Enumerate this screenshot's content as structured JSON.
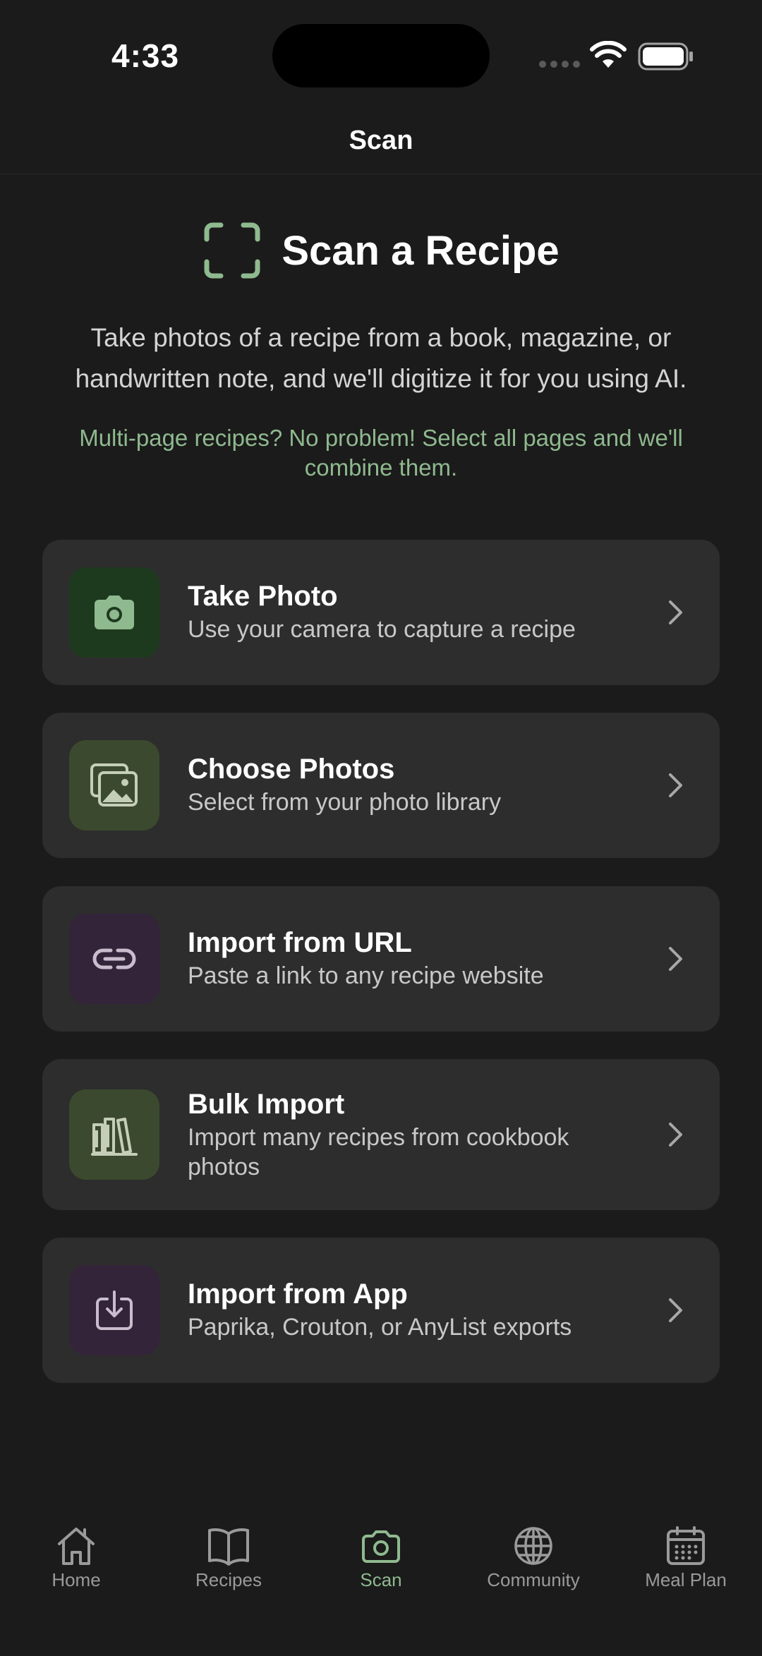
{
  "status_bar": {
    "time": "4:33"
  },
  "nav": {
    "title": "Scan"
  },
  "hero": {
    "title": "Scan a Recipe",
    "description": "Take photos of a recipe from a book, magazine, or handwritten note, and we'll digitize it for you using AI.",
    "note": "Multi-page recipes? No problem! Select all pages and we'll combine them."
  },
  "options": [
    {
      "title": "Take Photo",
      "subtitle": "Use your camera to capture a recipe",
      "icon": "camera-icon",
      "icon_bg": "#1e3a1e",
      "icon_color": "#8fb98f"
    },
    {
      "title": "Choose Photos",
      "subtitle": "Select from your photo library",
      "icon": "photos-icon",
      "icon_bg": "#3b4a2e",
      "icon_color": "#c5cfb8"
    },
    {
      "title": "Import from URL",
      "subtitle": "Paste a link to any recipe website",
      "icon": "link-icon",
      "icon_bg": "#33243a",
      "icon_color": "#c9bccd"
    },
    {
      "title": "Bulk Import",
      "subtitle": "Import many recipes from cookbook photos",
      "icon": "books-icon",
      "icon_bg": "#3b4a2e",
      "icon_color": "#c5cfb8"
    },
    {
      "title": "Import from App",
      "subtitle": "Paprika, Crouton, or AnyList exports",
      "icon": "download-icon",
      "icon_bg": "#33243a",
      "icon_color": "#c9bccd"
    }
  ],
  "tabs": [
    {
      "label": "Home",
      "icon": "home-icon",
      "active": false
    },
    {
      "label": "Recipes",
      "icon": "book-icon",
      "active": false
    },
    {
      "label": "Scan",
      "icon": "camera-icon",
      "active": true
    },
    {
      "label": "Community",
      "icon": "globe-icon",
      "active": false
    },
    {
      "label": "Meal Plan",
      "icon": "calendar-icon",
      "active": false
    }
  ],
  "colors": {
    "accent": "#8fb98f",
    "background": "#1b1b1b",
    "card": "#2d2d2d"
  }
}
